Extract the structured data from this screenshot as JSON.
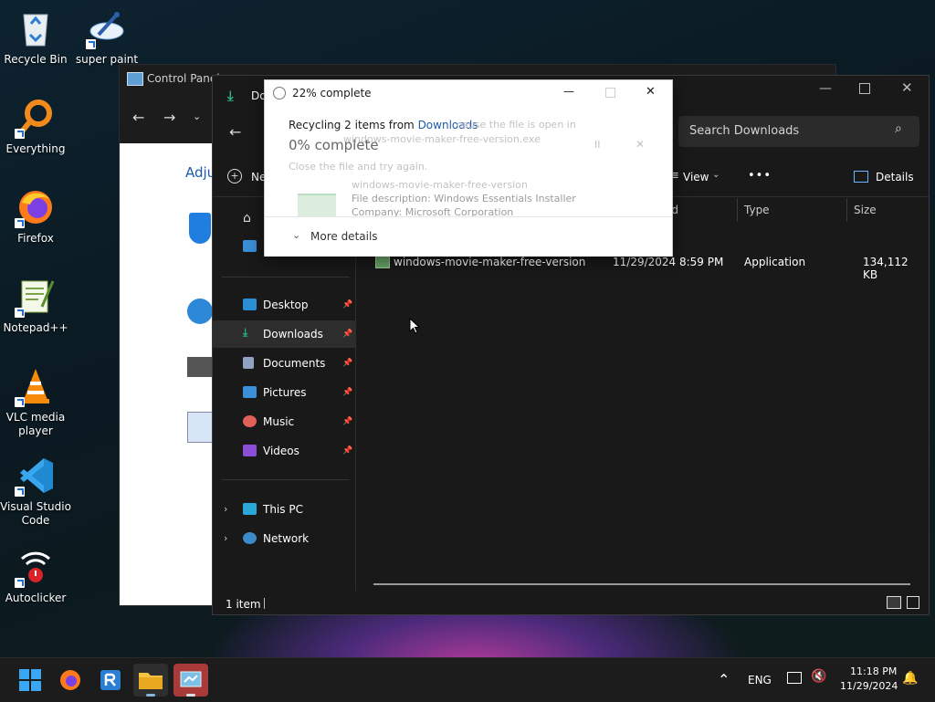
{
  "desktop": {
    "icons": [
      {
        "label": "Recycle Bin"
      },
      {
        "label": "super paint"
      },
      {
        "label": "Everything"
      },
      {
        "label": "Firefox"
      },
      {
        "label": "Notepad++"
      },
      {
        "label": "VLC media player"
      },
      {
        "label": "Visual Studio Code"
      },
      {
        "label": "Autoclicker"
      }
    ]
  },
  "control_panel": {
    "title": "Control Panel",
    "heading_partial": "Adju"
  },
  "explorer": {
    "title": "Do",
    "search_placeholder": "Search Downloads",
    "toolbar": {
      "new_label": "Ne",
      "view_label": "View",
      "more_label": "•••",
      "details_label": "Details"
    },
    "columns": {
      "date": "ed",
      "type": "Type",
      "size": "Size"
    },
    "files": [
      {
        "name": "windows-movie-maker-free-version",
        "date": "11/29/2024 8:59 PM",
        "type": "Application",
        "size": "134,112 KB"
      }
    ],
    "sidebar": {
      "quick": [
        {
          "label": "Desktop",
          "icon": "desktop-icon",
          "color": "#2b8fd6"
        },
        {
          "label": "Downloads",
          "icon": "download-icon",
          "color": "#2bb08a"
        },
        {
          "label": "Documents",
          "icon": "document-icon",
          "color": "#8fa3c0"
        },
        {
          "label": "Pictures",
          "icon": "pictures-icon",
          "color": "#3a8fd8"
        },
        {
          "label": "Music",
          "icon": "music-icon",
          "color": "#e0605a"
        },
        {
          "label": "Videos",
          "icon": "videos-icon",
          "color": "#8a4fd6"
        }
      ],
      "this_pc": "This PC",
      "network": "Network"
    },
    "status": "1 item"
  },
  "dialog": {
    "title": "22% complete",
    "recycling_prefix": "Recycling 2 items from ",
    "recycling_link": "Downloads",
    "progress": "0% complete",
    "ghost_line1": "cause the file is open in",
    "ghost_file": "windows-movie-maker-free-version.exe",
    "ghost_close_hint": "Close the file and try again.",
    "ghost_name": "windows-movie-maker-free-version",
    "ghost_desc": "File description: Windows Essentials Installer",
    "ghost_company": "Company: Microsoft Corporation",
    "more_details": "More details",
    "minimize": "—",
    "close": "✕"
  },
  "taskbar": {
    "lang": "ENG",
    "time": "11:18 PM",
    "date": "11/29/2024",
    "chevron": "⌃"
  },
  "colors": {
    "accent": "#1e5aa8",
    "explorer_bg": "#191919",
    "taskbar_bg": "#1c1c1c"
  }
}
